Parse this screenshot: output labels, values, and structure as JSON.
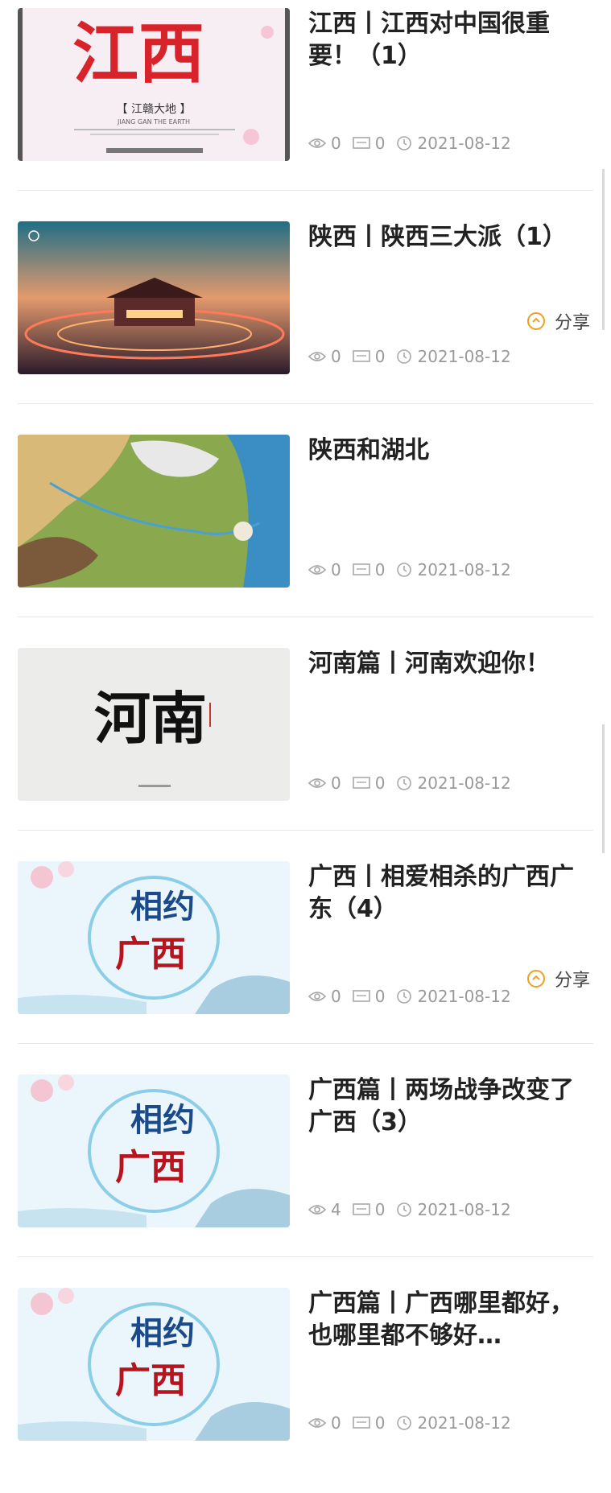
{
  "articles": [
    {
      "title": "江西丨江西对中国很重要！（1）",
      "views": "0",
      "comments": "0",
      "date": "2021-08-12"
    },
    {
      "title": "陕西丨陕西三大派（1）",
      "views": "0",
      "comments": "0",
      "date": "2021-08-12"
    },
    {
      "title": "陕西和湖北",
      "views": "0",
      "comments": "0",
      "date": "2021-08-12"
    },
    {
      "title": "河南篇丨河南欢迎你！",
      "views": "0",
      "comments": "0",
      "date": "2021-08-12"
    },
    {
      "title": "广西丨相爱相杀的广西广东（4）",
      "views": "0",
      "comments": "0",
      "date": "2021-08-12"
    },
    {
      "title": "广西篇丨两场战争改变了广西（3）",
      "views": "4",
      "comments": "0",
      "date": "2021-08-12"
    },
    {
      "title": "广西篇丨广西哪里都好，也哪里都不够好…",
      "views": "0",
      "comments": "0",
      "date": "2021-08-12"
    }
  ],
  "thumbs": {
    "jiangxi": {
      "big": "江西",
      "tag": "【 江赣大地 】",
      "sub": "JIANG GAN THE EARTH"
    },
    "henan": {
      "big": "河南"
    },
    "guangxi": {
      "big1": "相约",
      "big2": "广西"
    }
  },
  "share_label": "分享",
  "colors": {
    "accent": "#f0a020",
    "meta": "#9a9a9a",
    "title": "#222222"
  }
}
